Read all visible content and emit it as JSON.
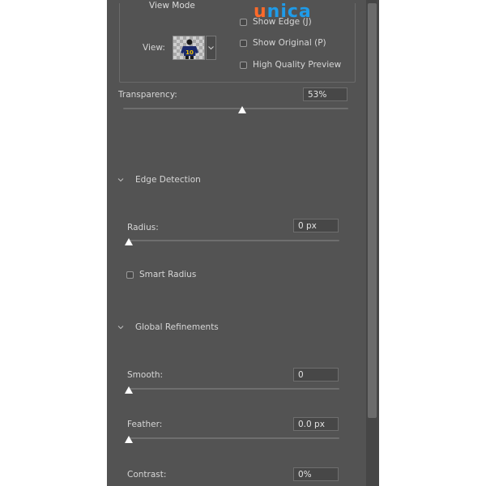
{
  "logo": {
    "u": "u",
    "rest": "nica"
  },
  "view_mode": {
    "title": "View Mode",
    "view_label": "View:",
    "checkboxes": [
      {
        "label": "Show Edge (J)",
        "checked": false
      },
      {
        "label": "Show Original (P)",
        "checked": false
      },
      {
        "label": "High Quality Preview",
        "checked": false
      }
    ]
  },
  "transparency": {
    "label": "Transparency:",
    "value": "53%",
    "level": 0.53
  },
  "edge_detection": {
    "title": "Edge Detection",
    "radius": {
      "label": "Radius:",
      "value": "0 px",
      "level": 0
    },
    "smart_radius": {
      "label": "Smart Radius",
      "checked": false
    }
  },
  "global_refinements": {
    "title": "Global Refinements",
    "smooth": {
      "label": "Smooth:",
      "value": "0",
      "level": 0
    },
    "feather": {
      "label": "Feather:",
      "value": "0.0 px",
      "level": 0
    },
    "contrast": {
      "label": "Contrast:",
      "value": "0%",
      "level": 0
    }
  },
  "colors": {
    "panel": "#535353",
    "logo_orange": "#ff6a2a",
    "logo_blue": "#1f9be8"
  }
}
